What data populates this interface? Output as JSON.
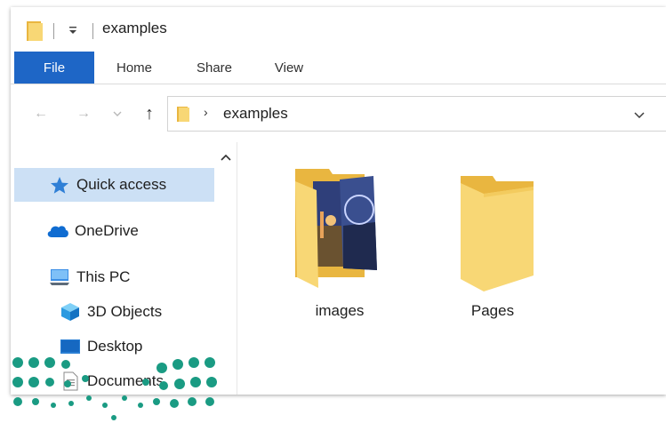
{
  "window": {
    "title": "examples"
  },
  "ribbon": {
    "tabs": [
      "File",
      "Home",
      "Share",
      "View"
    ]
  },
  "address": {
    "path": "examples"
  },
  "nav_pane": {
    "items": [
      {
        "label": "Quick access",
        "icon": "star-icon"
      },
      {
        "label": "OneDrive",
        "icon": "cloud-icon"
      },
      {
        "label": "This PC",
        "icon": "computer-icon"
      },
      {
        "label": "3D Objects",
        "icon": "cube-icon"
      },
      {
        "label": "Desktop",
        "icon": "desktop-icon"
      },
      {
        "label": "Documents",
        "icon": "document-icon"
      }
    ]
  },
  "content": {
    "items": [
      {
        "name": "images",
        "icon": "folder-with-photos-icon"
      },
      {
        "name": "Pages",
        "icon": "folder-icon"
      }
    ]
  },
  "colors": {
    "file_tab": "#1e66c6",
    "selection": "#cce0f5",
    "folder": "#f8d775",
    "brand_dots": "#1a9b83"
  }
}
